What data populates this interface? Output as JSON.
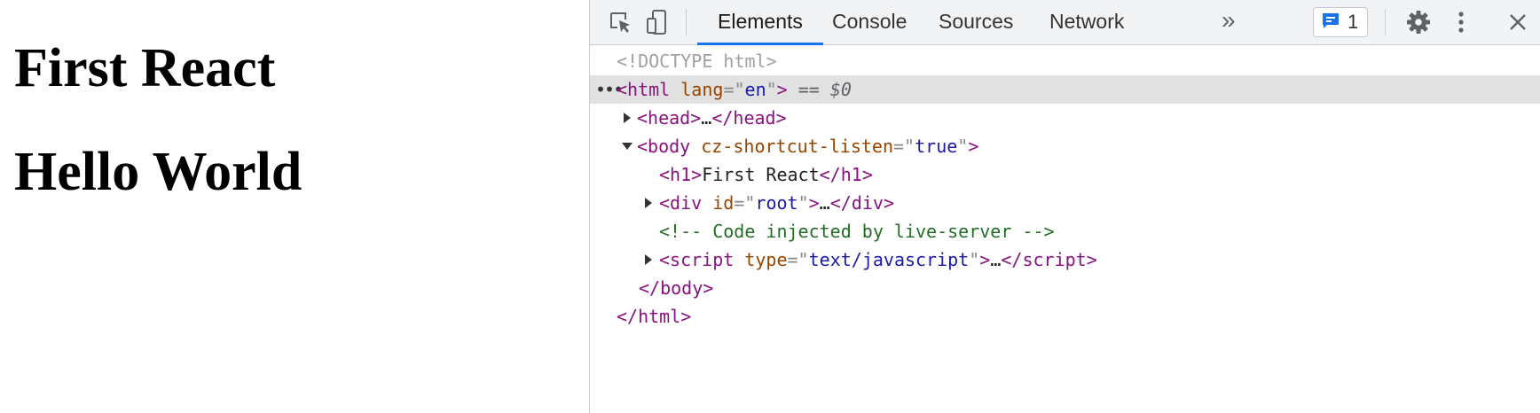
{
  "page": {
    "heading_1": "First React",
    "heading_2": "Hello World"
  },
  "devtools": {
    "tabs": [
      {
        "label": "Elements",
        "active": true
      },
      {
        "label": "Console"
      },
      {
        "label": "Sources"
      },
      {
        "label": "Network"
      }
    ],
    "more_tabs": "»",
    "issues_count": "1",
    "icons": [
      "inspect-element-icon",
      "device-toolbar-icon",
      "issues-icon",
      "gear-icon",
      "kebab-menu-icon",
      "close-icon"
    ],
    "accent_color": "#1a73e8",
    "dom": {
      "doctype": "<!DOCTYPE html>",
      "html_open": "<html",
      "html_attr": "lang",
      "html_attr_value": "en",
      "selected_marker": "== $0",
      "head": "head",
      "body": "body",
      "body_attr": "cz-shortcut-listen",
      "body_attr_value": "true",
      "h1_tag": "h1",
      "h1_text": "First React",
      "div_tag": "div",
      "div_attr": "id",
      "div_attr_value": "root",
      "comment": "<!-- Code injected by live-server -->",
      "script_tag": "script",
      "script_attr": "type",
      "script_attr_value": "text/javascript",
      "ellipsis": "…",
      "body_close": "</body>",
      "html_close": "</html>"
    }
  }
}
